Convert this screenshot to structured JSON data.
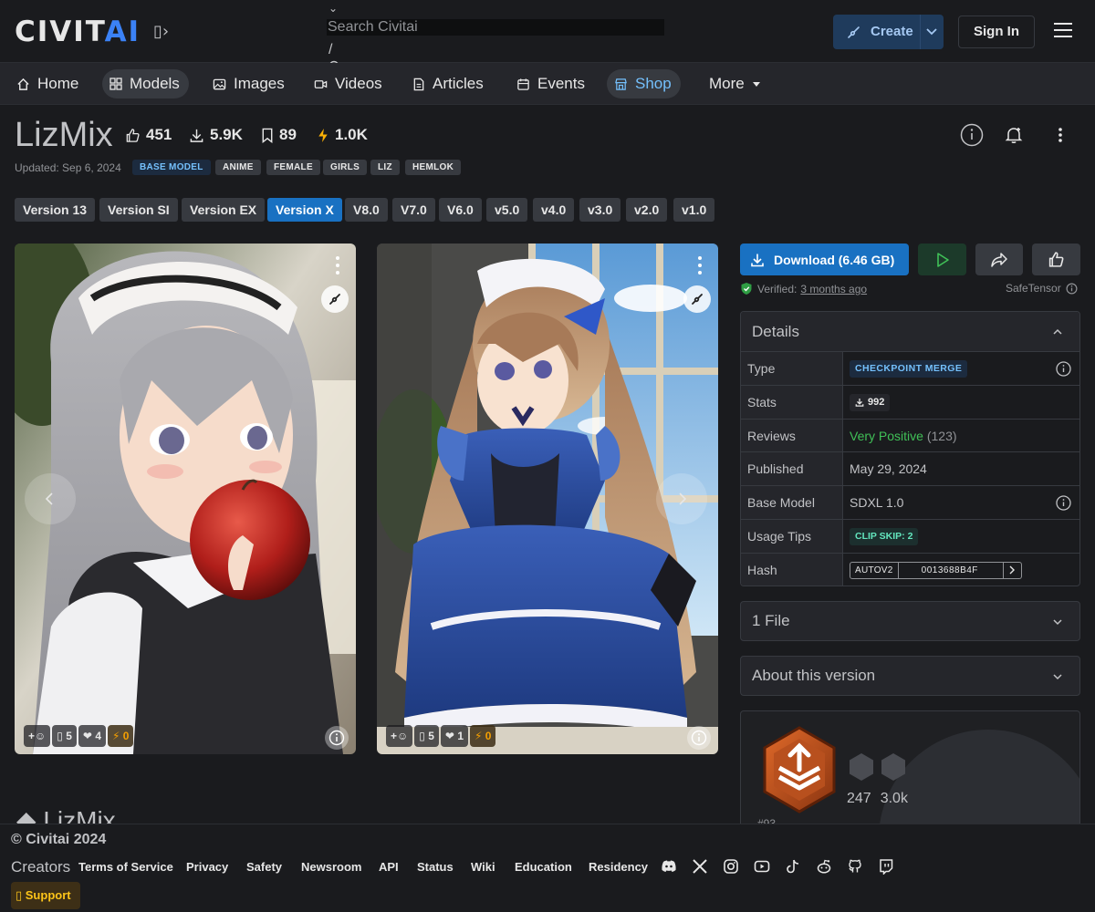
{
  "header": {
    "logo": {
      "main": "CIVIT",
      "accent": "AI"
    },
    "logo_extra": "▯›",
    "search": {
      "placeholder": "Search Civitai",
      "slash_hint": "/"
    },
    "create_label": "Create",
    "signin_label": "Sign In"
  },
  "nav": {
    "items": [
      {
        "label": "Home"
      },
      {
        "label": "Models"
      },
      {
        "label": "Images"
      },
      {
        "label": "Videos"
      },
      {
        "label": "Articles"
      },
      {
        "label": "Events"
      },
      {
        "label": "Shop"
      },
      {
        "label": "More"
      }
    ]
  },
  "model": {
    "title": "LizMix",
    "stats": {
      "likes": "451",
      "downloads": "5.9K",
      "bookmarks": "89",
      "buzz": "1.0K"
    },
    "updated": "Updated: Sep 6, 2024",
    "base_tag": "BASE MODEL",
    "tags": [
      "ANIME",
      "FEMALE",
      "GIRLS",
      "LIZ",
      "HEMLOK"
    ],
    "partial_heading": "LizMix"
  },
  "versions": [
    "Version 13",
    "Version SI",
    "Version EX",
    "Version X",
    "V8.0",
    "V7.0",
    "V6.0",
    "v5.0",
    "v4.0",
    "v3.0",
    "v2.0",
    "v1.0"
  ],
  "active_version": "Version X",
  "images": [
    {
      "comments": "5",
      "hearts": "4",
      "buzz": "0"
    },
    {
      "comments": "5",
      "hearts": "1",
      "buzz": "0"
    }
  ],
  "reaction_add": "+☺",
  "download": {
    "label": "Download (6.46 GB)",
    "verified_prefix": "Verified:",
    "verified_link": "3 months ago",
    "safetensor": "SafeTensor"
  },
  "details": {
    "heading": "Details",
    "type_label": "Type",
    "type_value": "CHECKPOINT MERGE",
    "stats_label": "Stats",
    "stats_value": "992",
    "reviews_label": "Reviews",
    "reviews_value": "Very Positive",
    "reviews_count": "(123)",
    "published_label": "Published",
    "published_value": "May 29, 2024",
    "base_label": "Base Model",
    "base_value": "SDXL 1.0",
    "tips_label": "Usage Tips",
    "tips_value": "CLIP SKIP: 2",
    "hash_label": "Hash",
    "hash_type": "AUTOV2",
    "hash_value": "0013688B4F"
  },
  "accordions": {
    "files": "1 File",
    "about": "About this version"
  },
  "creator": {
    "stat_a": "247",
    "stat_b": "3.0k",
    "rank": "#93"
  },
  "footer": {
    "copyright": "© Civitai 2024",
    "creators": "Creators",
    "links": [
      "Terms of Service",
      "Privacy",
      "Safety",
      "Newsroom",
      "API",
      "Status",
      "Wiki",
      "Education",
      "Residency"
    ],
    "support": "▯ Support"
  },
  "colors": {
    "accent": "#1971c2",
    "bg": "#1a1b1e",
    "panel": "#25262b",
    "positive": "#40c057",
    "buzz": "#f59f00"
  }
}
